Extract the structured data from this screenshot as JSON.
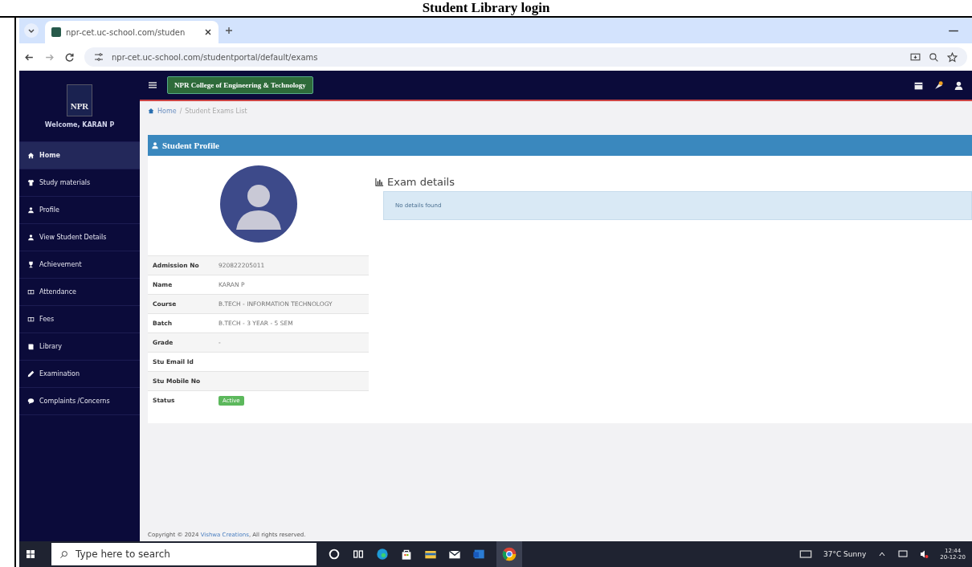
{
  "document": {
    "heading": "Student Library login"
  },
  "browser": {
    "tab_title": "npr-cet.uc-school.com/studen",
    "url": "npr-cet.uc-school.com/studentportal/default/exams"
  },
  "sidebar": {
    "logo": "NPR",
    "welcome": "Welcome, KARAN P",
    "items": [
      {
        "label": "Home",
        "selected": true
      },
      {
        "label": "Study materials",
        "selected": false
      },
      {
        "label": "Profile",
        "selected": false
      },
      {
        "label": "View Student Details",
        "selected": false
      },
      {
        "label": "Achievement",
        "selected": false
      },
      {
        "label": "Attendance",
        "selected": false
      },
      {
        "label": "Fees",
        "selected": false
      },
      {
        "label": "Library",
        "selected": false
      },
      {
        "label": "Examination",
        "selected": false
      },
      {
        "label": "Complaints /Concerns",
        "selected": false
      }
    ]
  },
  "header": {
    "college": "NPR College of Engineering & Technology"
  },
  "breadcrumb": {
    "items": [
      "Home",
      "Student Exams List"
    ],
    "separator": "/"
  },
  "profile": {
    "title": "Student Profile",
    "rows": [
      {
        "label": "Admission No",
        "value": "920822205011"
      },
      {
        "label": "Name",
        "value": "KARAN P"
      },
      {
        "label": "Course",
        "value": "B.TECH - INFORMATION TECHNOLOGY"
      },
      {
        "label": "Batch",
        "value": "B.TECH - 3 YEAR - 5 SEM"
      },
      {
        "label": "Grade",
        "value": "-"
      },
      {
        "label": "Stu Email Id"
      },
      {
        "label": "Stu Mobile No"
      },
      {
        "label": "Status",
        "badge": "Active"
      }
    ]
  },
  "exams": {
    "title": "Exam details",
    "message": "No details found"
  },
  "footer": {
    "copyright": "Copyright © 2024 ",
    "link": "Vishwa Creations",
    "rest": ", All rights reserved."
  },
  "taskbar": {
    "search_placeholder": "Type here to search",
    "weather": "37°C  Sunny",
    "time": "12:44",
    "date": "20-12-20"
  }
}
